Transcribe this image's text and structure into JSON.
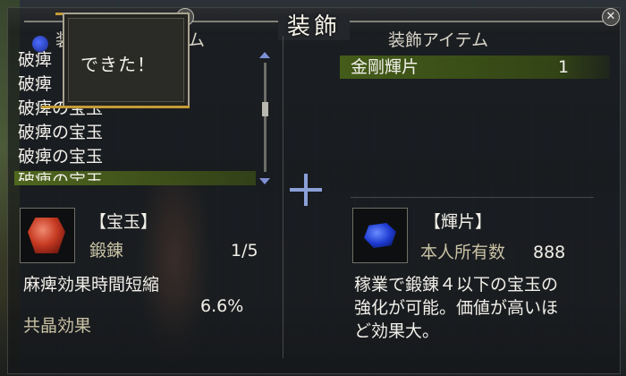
{
  "title": "装飾",
  "popup": {
    "text": "できた！"
  },
  "left": {
    "header_partial_left": "装",
    "header_partial_right": "ム",
    "items": [
      "破痺",
      "破痺",
      "破痺の宝玉",
      "破痺の宝玉",
      "破痺の宝玉",
      "破痺の宝玉"
    ],
    "selected_index": 5,
    "detail": {
      "category": "【宝玉】",
      "type": "鍛錬",
      "level": "1/5",
      "effect": "麻痺効果時間短縮",
      "effect_value": "6.6%",
      "shared_label": "共晶効果"
    }
  },
  "right": {
    "header": "装飾アイテム",
    "items": [
      {
        "name": "金剛輝片",
        "count": "1"
      }
    ],
    "detail": {
      "category": "【輝片】",
      "owned_label": "本人所有数",
      "owned_count": "888",
      "description_line1": "稼業で鍛錬４以下の宝玉の",
      "description_line2": "強化が可能。価値が高いほ",
      "description_line3": "ど効果大。"
    }
  },
  "colors": {
    "highlight_green": "#4f6a1a",
    "accent_gold": "#c49b35",
    "plus_blue": "#8aa0d8",
    "gem_red": "#c63a22",
    "gem_blue": "#1d3bd0"
  },
  "icons": {
    "close": "close-icon",
    "plus": "plus-icon",
    "scroll_up": "chevron-up-icon",
    "scroll_down": "chevron-down-icon"
  }
}
